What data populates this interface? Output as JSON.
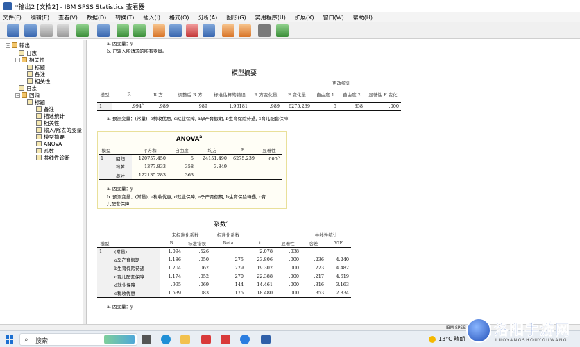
{
  "window": {
    "title": "*输出2 [文档2] - IBM SPSS Statistics 查看器"
  },
  "menu": [
    "文件(F)",
    "编辑(E)",
    "查看(V)",
    "数据(D)",
    "转换(T)",
    "插入(I)",
    "格式(O)",
    "分析(A)",
    "图形(G)",
    "实用程序(U)",
    "扩展(X)",
    "窗口(W)",
    "帮助(H)"
  ],
  "outline": {
    "items": [
      {
        "label": "输出",
        "kind": "book"
      },
      {
        "label": "日志",
        "kind": "page"
      },
      {
        "label": "相关性",
        "kind": "book"
      },
      {
        "label": "标题",
        "kind": "page"
      },
      {
        "label": "备注",
        "kind": "page"
      },
      {
        "label": "相关性",
        "kind": "page"
      },
      {
        "label": "日志",
        "kind": "page"
      },
      {
        "label": "回归",
        "kind": "book"
      },
      {
        "label": "标题",
        "kind": "page"
      },
      {
        "label": "备注",
        "kind": "page"
      },
      {
        "label": "描述统计",
        "kind": "page"
      },
      {
        "label": "相关性",
        "kind": "page"
      },
      {
        "label": "输入/除去的变量",
        "kind": "page"
      },
      {
        "label": "模型摘要",
        "kind": "page"
      },
      {
        "label": "ANOVA",
        "kind": "page"
      },
      {
        "label": "系数",
        "kind": "page"
      },
      {
        "label": "共线性诊断",
        "kind": "page"
      }
    ]
  },
  "viewer": {
    "top_notes": [
      "a. 因变量：y",
      "b. 已输入所请求的所有变量。"
    ],
    "model_summary": {
      "title": "模型摘要",
      "group_header": "更改统计",
      "headers": [
        "模型",
        "R",
        "R 方",
        "调整后 R 方",
        "标准估算的错误",
        "R 方变化量",
        "F 变化量",
        "自由度 1",
        "自由度 2",
        "显著性 F 变化"
      ],
      "row": {
        "model": "1",
        "r": ".994",
        "r_sup": "a",
        "r2": ".989",
        "adj_r2": ".989",
        "se": "1.96181",
        "r2_change": ".989",
        "f_change": "6275.239",
        "df1": "5",
        "df2": "358",
        "sig_f": ".000"
      },
      "note": "a. 预测变量：(常量), e税收优惠, d就业保障, a孕产育假期, b生育保险待遇, c育儿配套保障"
    },
    "anova": {
      "title": "ANOVA",
      "title_sup": "a",
      "headers": [
        "模型",
        "",
        "平方和",
        "自由度",
        "均方",
        "F",
        "显著性"
      ],
      "model": "1",
      "rows": [
        {
          "label": "回归",
          "ss": "120757.450",
          "df": "5",
          "ms": "24151.490",
          "f": "6275.239",
          "sig": ".000",
          "sig_sup": "b"
        },
        {
          "label": "残差",
          "ss": "1377.833",
          "df": "358",
          "ms": "3.849",
          "f": "",
          "sig": "",
          "sig_sup": ""
        },
        {
          "label": "总计",
          "ss": "122135.283",
          "df": "363",
          "ms": "",
          "f": "",
          "sig": "",
          "sig_sup": ""
        }
      ],
      "notes": [
        "a. 因变量：y",
        "b. 预测变量：(常量), e税收优惠, d就业保障, a孕产育假期, b生育保险待遇, c育",
        "儿配套保障"
      ]
    },
    "coefficients": {
      "title": "系数",
      "title_sup": "a",
      "group_headers": {
        "unstd": "未标准化系数",
        "std": "标准化系数",
        "collin": "共线性统计"
      },
      "headers": [
        "模型",
        "",
        "B",
        "标准错误",
        "Beta",
        "t",
        "显著性",
        "容差",
        "VIF"
      ],
      "model": "1",
      "rows": [
        {
          "label": "(常量)",
          "b": "1.094",
          "se": ".526",
          "beta": "",
          "t": "2.078",
          "sig": ".038",
          "tol": "",
          "vif": ""
        },
        {
          "label": "a孕产育假期",
          "b": "1.186",
          "se": ".050",
          "beta": ".275",
          "t": "23.806",
          "sig": ".000",
          "tol": ".236",
          "vif": "4.240"
        },
        {
          "label": "b生育保险待遇",
          "b": "1.204",
          "se": ".062",
          "beta": ".229",
          "t": "19.302",
          "sig": ".000",
          "tol": ".223",
          "vif": "4.482"
        },
        {
          "label": "c育儿配套保障",
          "b": "1.174",
          "se": ".052",
          "beta": ".270",
          "t": "22.388",
          "sig": ".000",
          "tol": ".217",
          "vif": "4.619"
        },
        {
          "label": "d就业保障",
          "b": ".995",
          "se": ".069",
          "beta": ".144",
          "t": "14.461",
          "sig": ".000",
          "tol": ".316",
          "vif": "3.163"
        },
        {
          "label": "e税收优惠",
          "b": "1.539",
          "se": ".083",
          "beta": ".175",
          "t": "18.480",
          "sig": ".000",
          "tol": ".353",
          "vif": "2.834"
        }
      ],
      "note": "a. 因变量：y"
    }
  },
  "statusbar": {
    "text": "IBM SPSS"
  },
  "taskbar": {
    "search_placeholder": "搜索",
    "weather": "13°C 晴朗"
  },
  "watermark": {
    "text": "洛阳手游网",
    "sub": "LUOYANGSHOUYOUWANG"
  },
  "colors": {
    "watermark": "#1f4fb5",
    "accent": "#2f5fa8"
  }
}
